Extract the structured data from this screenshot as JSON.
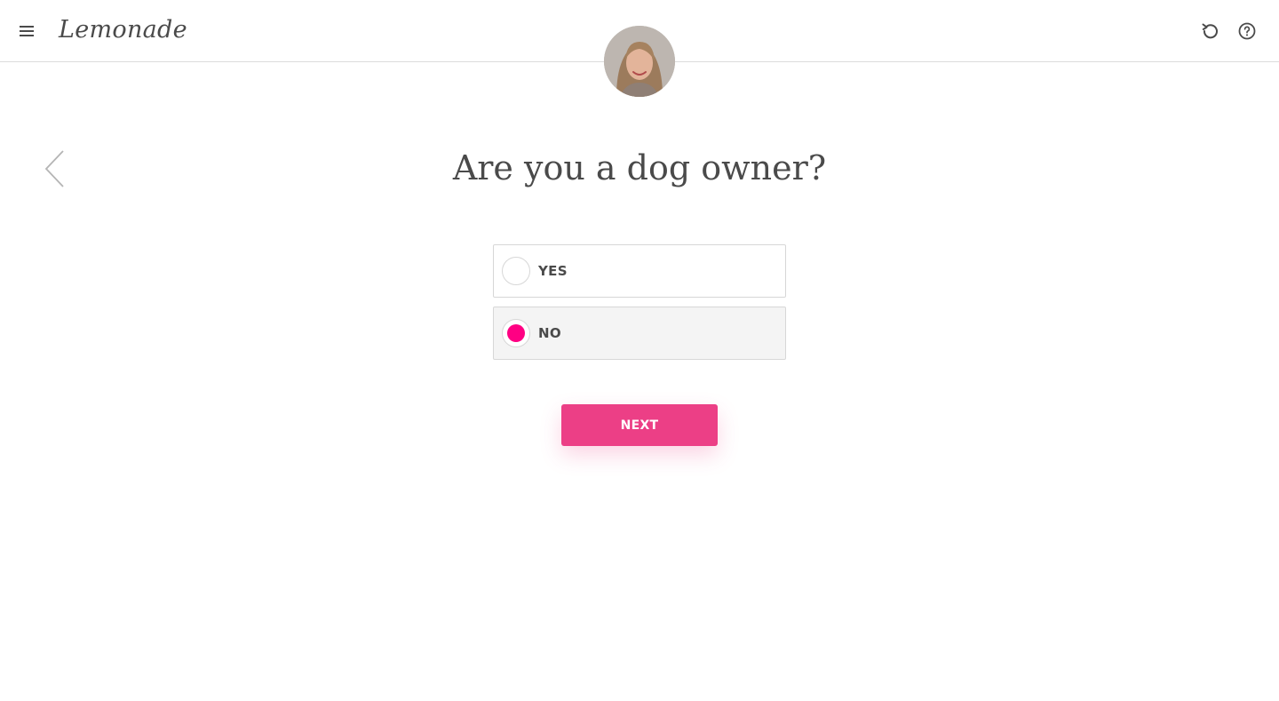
{
  "header": {
    "logo_text": "Lemonade",
    "menu_icon": "hamburger-menu-icon",
    "restart_icon": "restart-icon",
    "help_icon": "help-icon"
  },
  "assistant": {
    "avatar_icon": "assistant-avatar"
  },
  "nav": {
    "back_icon": "chevron-left-icon"
  },
  "question": {
    "text": "Are you a dog owner?"
  },
  "options": [
    {
      "label": "YES",
      "selected": false
    },
    {
      "label": "NO",
      "selected": true
    }
  ],
  "next_button": {
    "label": "NEXT"
  },
  "colors": {
    "accent": "#ec3f86",
    "radio_selected": "#ff0083",
    "text": "#4a4a4a",
    "border": "#d7d7d7",
    "selected_bg": "#f4f4f4"
  }
}
